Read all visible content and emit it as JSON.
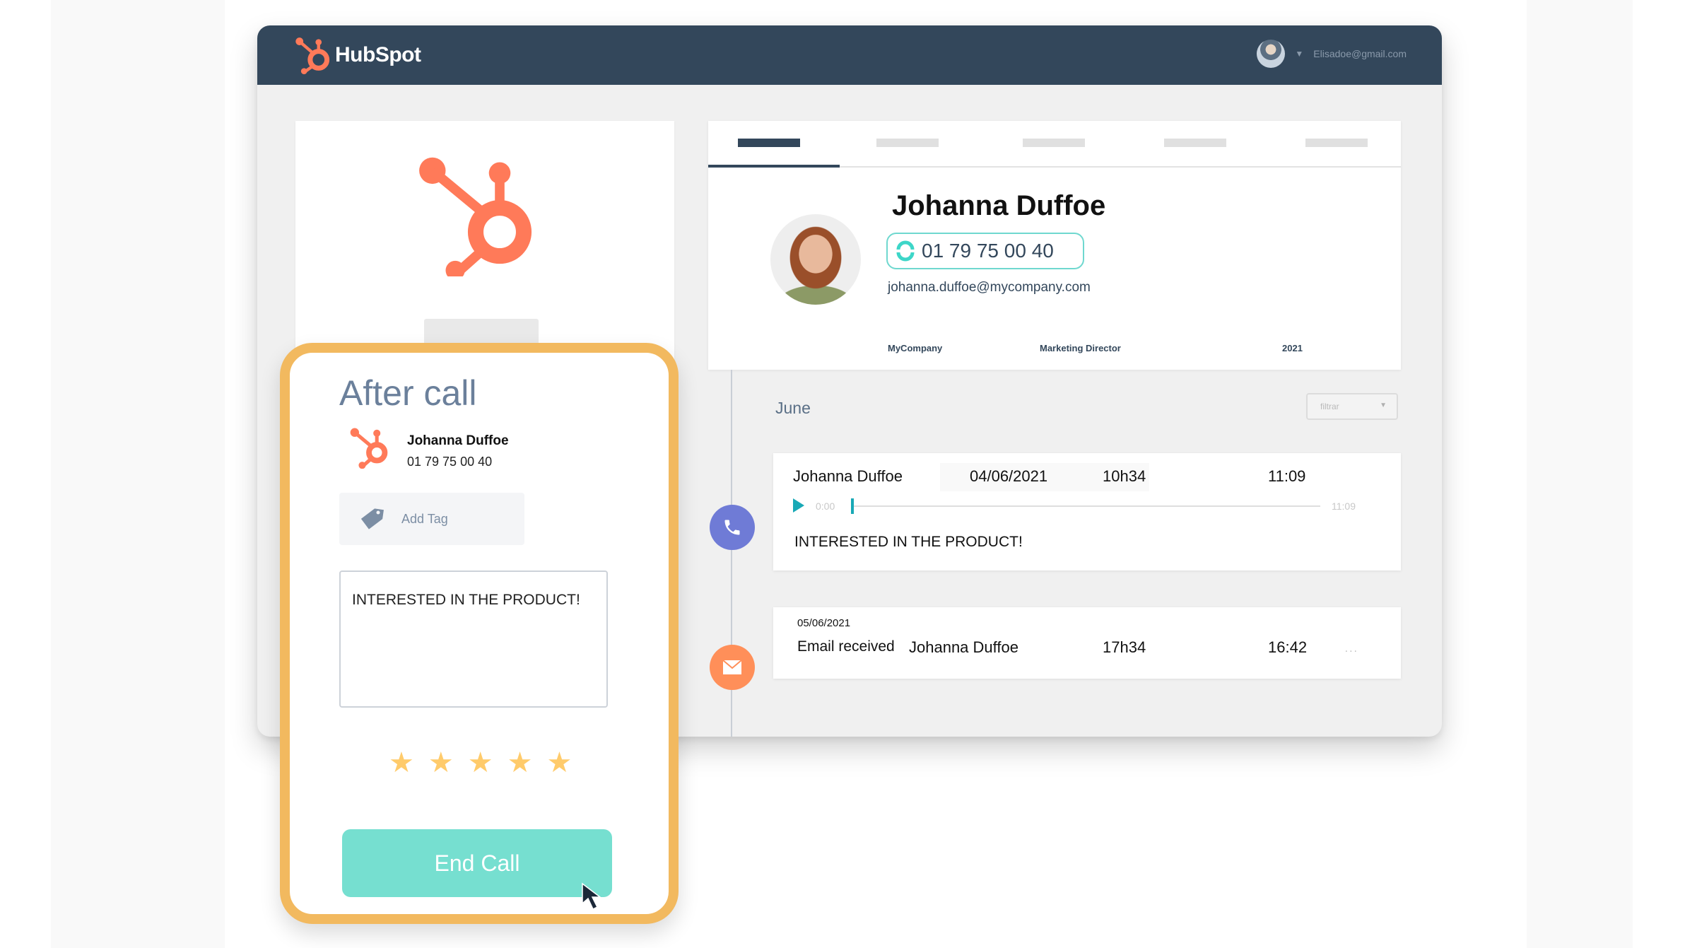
{
  "header": {
    "brand": "HubSpot",
    "user_email": "Elisadoe@gmail.com"
  },
  "profile": {
    "tabs": [
      {
        "active": true
      },
      {
        "active": false
      },
      {
        "active": false
      },
      {
        "active": false
      },
      {
        "active": false
      }
    ],
    "name": "Johanna Duffoe",
    "phone": "01 79 75 00 40",
    "email": "johanna.duffoe@mycompany.com",
    "company": "MyCompany",
    "job_title": "Marketing Director",
    "year": "2021"
  },
  "timeline": {
    "month": "June",
    "filter_placeholder": "filtrar",
    "events": [
      {
        "type": "call",
        "contact": "Johanna Duffoe",
        "date": "04/06/2021",
        "time": "10h34",
        "duration": "11:09",
        "player_start": "0:00",
        "player_end": "11:09",
        "player_progress": 0,
        "note": "INTERESTED IN THE PRODUCT!"
      },
      {
        "type": "email",
        "date": "05/06/2021",
        "label": "Email received",
        "contact": "Johanna Duffoe",
        "time": "17h34",
        "duration": "16:42",
        "more": "..."
      }
    ]
  },
  "after_call": {
    "title": "After call",
    "contact_name": "Johanna Duffoe",
    "contact_phone": "01 79 75 00 40",
    "add_tag_label": "Add Tag",
    "note_value": "INTERESTED IN THE PRODUCT!",
    "rating": 5,
    "rating_max": 5,
    "end_call_label": "End Call"
  },
  "colors": {
    "brand_orange": "#ff7a59",
    "header_navy": "#33475b",
    "accent_teal": "#76dfd0",
    "highlight_border": "#f2b95f",
    "star": "#ffcb6b",
    "call_node": "#6f7bd6",
    "email_node": "#ff8f59"
  }
}
